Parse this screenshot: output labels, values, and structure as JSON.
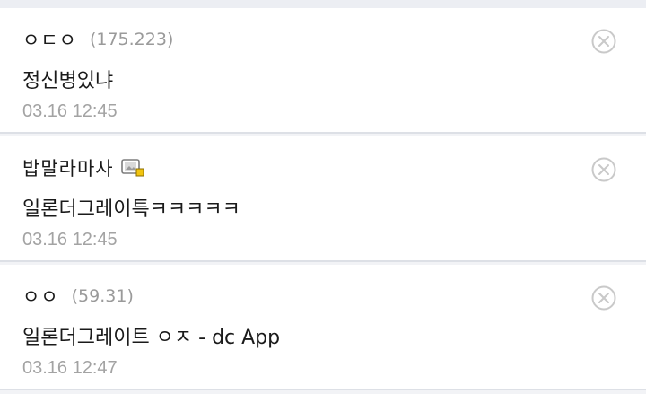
{
  "comments": [
    {
      "nickname": "ㅇㄷㅇ",
      "ip": "(175.223)",
      "text": "정신병있냐",
      "time": "03.16 12:45",
      "has_user_icon": false
    },
    {
      "nickname": "밥말라마사",
      "ip": "",
      "text": "일론더그레이특ㅋㅋㅋㅋㅋ",
      "time": "03.16 12:45",
      "has_user_icon": true,
      "user_icon": "fixed-nickname-gallery-icon"
    },
    {
      "nickname": "ㅇㅇ",
      "ip": "(59.31)",
      "text": "일론더그레이트 ㅇㅈ - dc App",
      "time": "03.16 12:47",
      "has_user_icon": false
    }
  ],
  "delete_icon": "close-circle-icon",
  "colors": {
    "background": "#f2f3f6",
    "card": "#ffffff",
    "text": "#1a1a1a",
    "muted": "#9a9a9a",
    "icon": "#c9c9c9"
  }
}
